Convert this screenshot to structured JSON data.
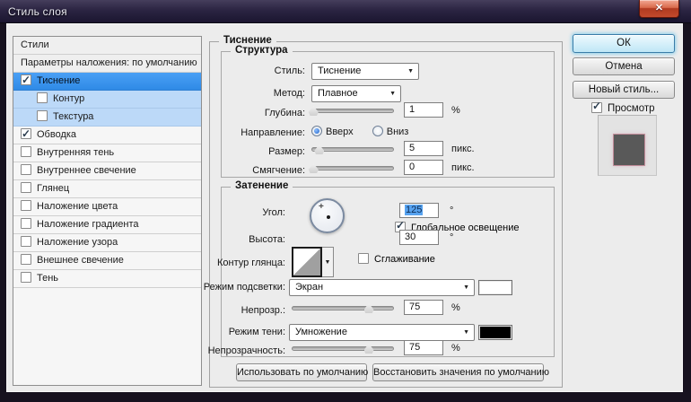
{
  "window": {
    "title": "Стиль слоя"
  },
  "icons": {
    "close": "✕",
    "check": "✓",
    "dropdown_arrow": "▼",
    "crosshair": "+"
  },
  "colors": {
    "selection_blue": "#3d97f2",
    "sub_row_blue": "#bcd9f8",
    "highlight_swatch": "#ffffff",
    "shadow_swatch": "#000000",
    "preview_fill": "#595959"
  },
  "sidebar": {
    "header": "Стили",
    "blend_options": "Параметры наложения: по умолчанию",
    "items": [
      {
        "label": "Тиснение",
        "checked": true,
        "selected": true
      },
      {
        "label": "Контур",
        "checked": false
      },
      {
        "label": "Текстура",
        "checked": false
      },
      {
        "label": "Обводка",
        "checked": true
      },
      {
        "label": "Внутренняя тень",
        "checked": false
      },
      {
        "label": "Внутреннее свечение",
        "checked": false
      },
      {
        "label": "Глянец",
        "checked": false
      },
      {
        "label": "Наложение цвета",
        "checked": false
      },
      {
        "label": "Наложение градиента",
        "checked": false
      },
      {
        "label": "Наложение узора",
        "checked": false
      },
      {
        "label": "Внешнее свечение",
        "checked": false
      },
      {
        "label": "Тень",
        "checked": false
      }
    ]
  },
  "main": {
    "group_title": "Тиснение",
    "structure": {
      "title": "Структура",
      "style_label": "Стиль:",
      "style_value": "Тиснение",
      "method_label": "Метод:",
      "method_value": "Плавное",
      "depth_label": "Глубина:",
      "depth_value": "1",
      "depth_unit": "%",
      "depth_thumb": "2%",
      "direction_label": "Направление:",
      "direction_up": "Вверх",
      "direction_down": "Вниз",
      "size_label": "Размер:",
      "size_value": "5",
      "size_unit": "пикс.",
      "size_thumb": "9%",
      "soften_label": "Смягчение:",
      "soften_value": "0",
      "soften_unit": "пикс.",
      "soften_thumb": "2%"
    },
    "shading": {
      "title": "Затенение",
      "angle_label": "Угол:",
      "angle_value": "125",
      "angle_unit": "°",
      "global_light_label": "Глобальное освещение",
      "altitude_label": "Высота:",
      "altitude_value": "30",
      "altitude_unit": "°",
      "gloss_contour_label": "Контур глянца:",
      "anti_alias_label": "Сглаживание",
      "highlight_mode_label": "Режим подсветки:",
      "highlight_mode_value": "Экран",
      "highlight_opacity_label": "Непрозр.:",
      "highlight_opacity_value": "75",
      "highlight_opacity_unit": "%",
      "highlight_opacity_thumb": "75%",
      "shadow_mode_label": "Режим тени:",
      "shadow_mode_value": "Умножение",
      "shadow_opacity_label": "Непрозрачность:",
      "shadow_opacity_value": "75",
      "shadow_opacity_unit": "%",
      "shadow_opacity_thumb": "75%"
    },
    "footer_buttons": {
      "make_default": "Использовать по умолчанию",
      "reset_default": "Восстановить значения по умолчанию"
    }
  },
  "actions": {
    "ok": "ОК",
    "cancel": "Отмена",
    "new_style": "Новый стиль...",
    "preview": "Просмотр"
  }
}
